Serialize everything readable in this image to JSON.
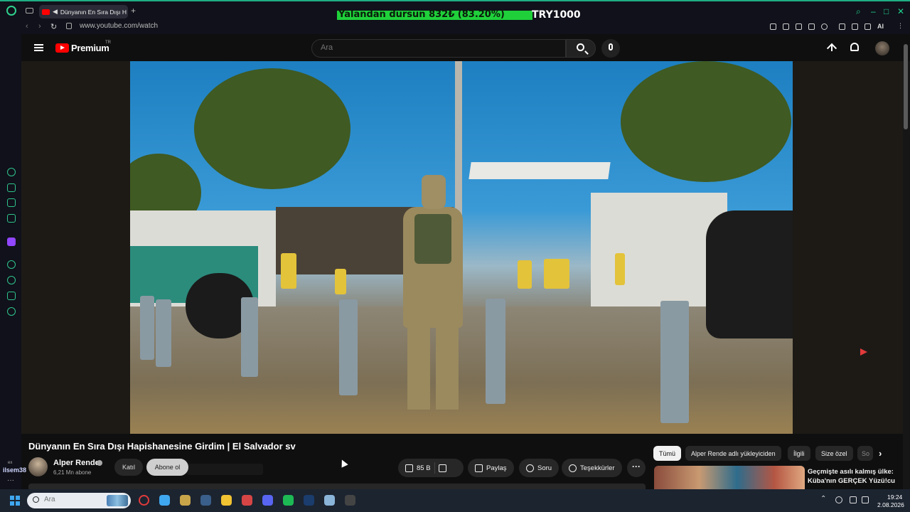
{
  "browser": {
    "tab_title": "Dünyanın En Sıra Dışı H",
    "new_tab": "+",
    "url": "www.youtube.com/watch",
    "ai_label": "AI"
  },
  "ticker": {
    "text": "Yalandan dursun  832₺ (83.20%)",
    "currency": "TRY1000",
    "progress_fraction": 0.832,
    "bar_color": "#1fd03a"
  },
  "sidebar": {
    "user_label": "ilsem38",
    "badge": "ex",
    "more": "···",
    "icons": [
      "refresh-icon",
      "bot-icon",
      "ticket-icon",
      "m-app-icon",
      "twitch-icon",
      "play-icon",
      "clock-icon",
      "cube-icon",
      "settings-icon"
    ]
  },
  "youtube": {
    "brand": "Premium",
    "region": "TR",
    "search_placeholder": "Ara"
  },
  "video": {
    "title": "Dünyanın En Sıra Dışı Hapishanesine Girdim | El Salvador sv",
    "channel": "Alper Rende",
    "subscribers": "6,21 Mn abone",
    "join": "Katıl",
    "subscribe": "Abone ol",
    "likes": "85 B",
    "share": "Paylaş",
    "ask": "Soru",
    "thanks": "Teşekkürler",
    "more": "···"
  },
  "recommendations": {
    "chips": [
      "Tümü",
      "Alper Rende adlı yükleyiciden",
      "İlgili",
      "Size özel",
      "So"
    ],
    "active_chip": "Tümü",
    "first_title": "Geçmişte asılı kalmış ülke: Küba'nın GERÇEK Yüzü!cu"
  },
  "taskbar": {
    "search_placeholder": "Ara",
    "time": "19:24",
    "date": "2.08.2026",
    "apps": [
      {
        "name": "opera-app",
        "color": "#e23b3b"
      },
      {
        "name": "store-app",
        "color": "#3fa7f0"
      },
      {
        "name": "league-app",
        "color": "#c9a54a"
      },
      {
        "name": "steam-app",
        "color": "#3a5f8a"
      },
      {
        "name": "explorer-app",
        "color": "#f1c232"
      },
      {
        "name": "acrobat-app",
        "color": "#d64545"
      },
      {
        "name": "discord-app",
        "color": "#5865f2"
      },
      {
        "name": "spotify-app",
        "color": "#1db954"
      },
      {
        "name": "photoshop-app",
        "color": "#1a3d6e"
      },
      {
        "name": "network-app",
        "color": "#8ab4d8"
      },
      {
        "name": "media-app",
        "color": "#444444"
      }
    ]
  }
}
